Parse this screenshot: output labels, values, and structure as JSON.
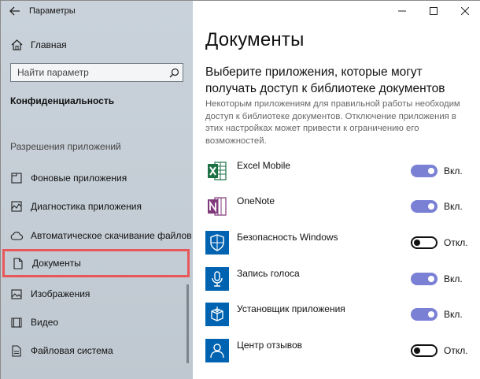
{
  "window": {
    "title": "Параметры"
  },
  "sidebar": {
    "home_label": "Главная",
    "search_placeholder": "Найти параметр",
    "section_title": "Конфиденциальность",
    "group_title": "Разрешения приложений",
    "items": [
      {
        "label": "Фоновые приложения",
        "icon": "background-apps-icon"
      },
      {
        "label": "Диагностика приложения",
        "icon": "diagnostics-icon"
      },
      {
        "label": "Автоматическое скачивание файлов",
        "icon": "cloud-icon"
      },
      {
        "label": "Документы",
        "icon": "document-icon",
        "selected": true
      },
      {
        "label": "Изображения",
        "icon": "image-icon"
      },
      {
        "label": "Видео",
        "icon": "video-icon"
      },
      {
        "label": "Файловая система",
        "icon": "file-system-icon"
      }
    ]
  },
  "main": {
    "title": "Документы",
    "subheading": "Выберите приложения, которые могут получать доступ к библиотеке документов",
    "description": "Некоторым приложениям для правильной работы необходим доступ к библиотеке документов. Отключение приложения в этих настройках может привести к ограничению его возможностей.",
    "apps": [
      {
        "name": "Excel Mobile",
        "state": "Вкл.",
        "on": true,
        "icon": "excel-icon",
        "color": "#1e7145"
      },
      {
        "name": "OneNote",
        "state": "Вкл.",
        "on": true,
        "icon": "onenote-icon",
        "color": "#80397b"
      },
      {
        "name": "Безопасность Windows",
        "state": "Откл.",
        "on": false,
        "icon": "shield-icon",
        "color": "#0063b1"
      },
      {
        "name": "Запись голоса",
        "state": "Вкл.",
        "on": true,
        "icon": "microphone-icon",
        "color": "#0063b1"
      },
      {
        "name": "Установщик приложения",
        "state": "Вкл.",
        "on": true,
        "icon": "installer-icon",
        "color": "#0063b1"
      },
      {
        "name": "Центр отзывов",
        "state": "Откл.",
        "on": false,
        "icon": "feedback-icon",
        "color": "#0063b1"
      }
    ]
  },
  "colors": {
    "accent": "#7a80d4",
    "highlight": "#e8575a",
    "sidebar_bg": "#c7d0d8"
  }
}
